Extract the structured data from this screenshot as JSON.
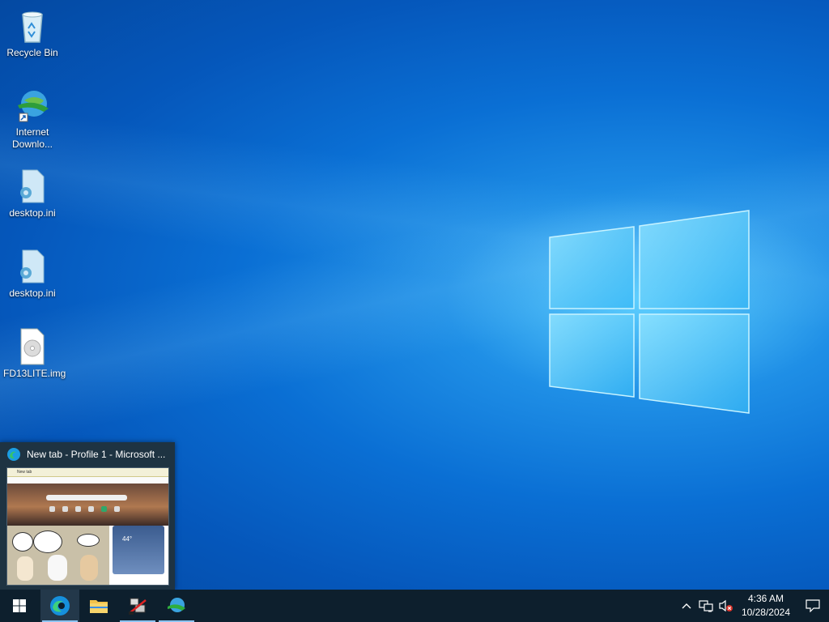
{
  "desktop": {
    "icons": [
      {
        "label": "Recycle Bin",
        "icon": "recycle-bin-icon"
      },
      {
        "label": "Internet Downlo...",
        "label_line1": "Internet",
        "label_line2": "Downlo...",
        "icon": "internet-download-manager-icon"
      },
      {
        "label": "desktop.ini",
        "icon": "settings-file-icon"
      },
      {
        "label": "desktop.ini",
        "icon": "settings-file-icon"
      },
      {
        "label": "FD13LITE.img",
        "icon": "disk-image-icon"
      }
    ]
  },
  "preview": {
    "title": "New tab - Profile 1 - Microsoft ...",
    "thumb": {
      "tab_label": "New tab",
      "weather_temp": "44°",
      "prompt": "Ask Copilot"
    }
  },
  "taskbar": {
    "apps": [
      {
        "name": "start",
        "icon": "windows-start-icon"
      },
      {
        "name": "edge",
        "icon": "edge-icon",
        "active": true
      },
      {
        "name": "file-explorer",
        "icon": "folder-icon"
      },
      {
        "name": "network-tool",
        "icon": "network-app-icon"
      },
      {
        "name": "idm",
        "icon": "internet-download-manager-icon"
      }
    ],
    "tray": {
      "time": "4:36 AM",
      "date": "10/28/2024"
    }
  },
  "colors": {
    "taskbar_bg": "#0d1f2d",
    "accent": "#8cc4f2",
    "desktop_blue": "#0a6fd4"
  }
}
